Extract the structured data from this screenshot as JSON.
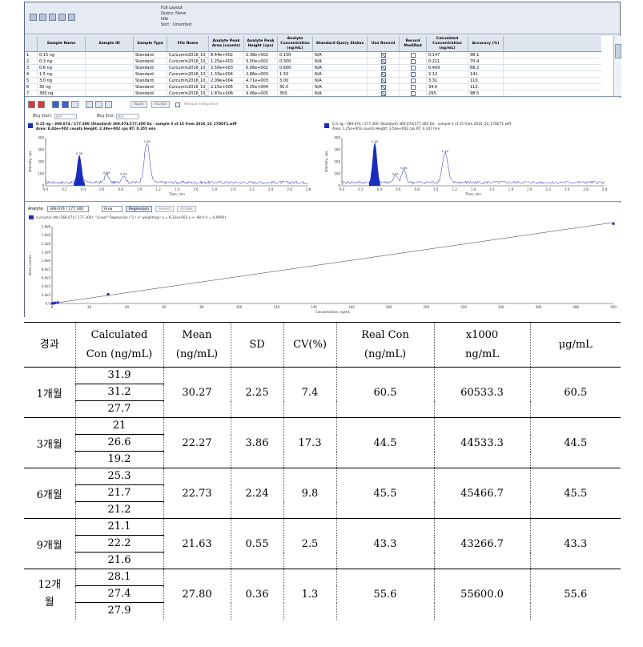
{
  "toolbar": {
    "info_lines": [
      "Full Layout",
      "Query: None",
      "Idle",
      "Sort : Unsorted"
    ]
  },
  "grid": {
    "columns": [
      "",
      "Sample Name",
      "Sample ID",
      "Sample Type",
      "File Name",
      "Analyte Peak Area (counts)",
      "Analyte Peak Height (cps)",
      "Analyte Concentration (ng/mL)",
      "Standard Query Status",
      "Use Record",
      "Record Modified",
      "Calculated Concentration (ng/mL)",
      "Accuracy (%)"
    ],
    "rows": [
      {
        "num": "1",
        "name": "0.15 ng",
        "id": "",
        "type": "Standard",
        "file": "Curcumin2016_10_",
        "area": "8.44e+002",
        "height": "2.38e+002",
        "conc": "0.150",
        "status": "N/A",
        "use": true,
        "mod": false,
        "calc": "0.147",
        "acc": "98.1"
      },
      {
        "num": "2",
        "name": "0.3 ng",
        "id": "",
        "type": "Standard",
        "file": "Curcumin2016_10_1",
        "area": "1.25e+003",
        "height": "3.50e+002",
        "conc": "0.300",
        "status": "N/A",
        "use": true,
        "mod": false,
        "calc": "0.211",
        "acc": "70.4"
      },
      {
        "num": "3",
        "name": "0.6 ng",
        "id": "",
        "type": "Standard",
        "file": "Curcumin2016_10_1",
        "area": "2.50e+003",
        "height": "6.06e+002",
        "conc": "0.600",
        "status": "N/A",
        "use": true,
        "mod": false,
        "calc": "0.409",
        "acc": "68.2"
      },
      {
        "num": "4",
        "name": "1.5 ng",
        "id": "",
        "type": "Standard",
        "file": "Curcumin2016_10_1",
        "area": "1.33e+004",
        "height": "2.86e+003",
        "conc": "1.50",
        "status": "N/A",
        "use": true,
        "mod": false,
        "calc": "2.12",
        "acc": "141."
      },
      {
        "num": "5",
        "name": "3.0 ng",
        "id": "",
        "type": "Standard",
        "file": "Curcumin2016_10_1",
        "area": "2.09e+004",
        "height": "4.71e+003",
        "conc": "3.00",
        "status": "N/A",
        "use": true,
        "mod": false,
        "calc": "3.31",
        "acc": "110."
      },
      {
        "num": "6",
        "name": "30 ng",
        "id": "",
        "type": "Standard",
        "file": "Curcumin2016_10_1",
        "area": "2.15e+005",
        "height": "5.35e+004",
        "conc": "30.0",
        "status": "N/A",
        "use": true,
        "mod": false,
        "calc": "34.0",
        "acc": "113."
      },
      {
        "num": "7",
        "name": "300 ng",
        "id": "",
        "type": "Standard",
        "file": "Curcumin2016_10_1",
        "area": "1.87e+006",
        "height": "4.06e+005",
        "conc": "300.",
        "status": "N/A",
        "use": true,
        "mod": false,
        "calc": "295.",
        "acc": "98.5"
      }
    ]
  },
  "chrom_toolbar": {
    "apply": "Apply",
    "accept": "Accept",
    "manual": "Manual Integration",
    "bkg_start_label": "Bkg Start:",
    "bkg_start_value": "N/A",
    "bkg_end_label": "Bkg End:",
    "bkg_end_value": "N/A"
  },
  "chrom_left": {
    "title_line1": "0.15 ng - 369.074 / 177.300 (Standard) 369.074/177.300 Da - sample 3 of 15 from 2016_10_17DET1.wiff",
    "title_line2": "Area: 8.44e+002 counts  Height: 2.38e+002 cps  RT: 0.355 min",
    "ylabel": "Intensity, cps",
    "xlabel": "Time, min",
    "yticks": [
      "400",
      "300",
      "200",
      "100",
      "0"
    ],
    "xticks": [
      "0.0",
      "0.2",
      "0.4",
      "0.6",
      "0.8",
      "1.0",
      "1.2",
      "1.4",
      "1.6",
      "1.8",
      "2.0",
      "2.2",
      "2.4",
      "2.6",
      "2.8"
    ],
    "peak_labels": [
      "0.36",
      "1.08",
      "0.65",
      "0.83"
    ]
  },
  "chrom_right": {
    "title_line1": "0.3 ng - 369.074 / 177.300 (Standard) 369.074/177.300 Da - sample 4 of 15 from 2016_10_17DET1.wiff",
    "title_line2": "Area: 1.25e+003 counts  Height: 3.50e+002 cps  RT: 0.347 min",
    "ylabel": "Intensity, cps",
    "xlabel": "Time, min",
    "yticks": [
      "400",
      "300",
      "200",
      "100",
      "0"
    ],
    "xticks": [
      "0.0",
      "0.2",
      "0.4",
      "0.6",
      "0.8",
      "1.0",
      "1.2",
      "1.4",
      "1.6",
      "1.8",
      "2.0",
      "2.2",
      "2.4",
      "2.6",
      "2.8"
    ],
    "peak_labels": [
      "0.35",
      "1.10",
      "0.66",
      "0.57"
    ]
  },
  "calib": {
    "analyte_label": "Analyte:",
    "analyte_value": "369.074 / 177.300",
    "area_value": "Area",
    "regression_btn": "Regression",
    "revert_btn": "Revert",
    "accept_btn": "Accept",
    "equation": "curcumin.rdb (369.074 / 177.300): \"Linear\" Regression (\"1 / x\" weighting): y = 6.32e+003 x + -98.0 (r = 0.9995)",
    "ylabel": "Area, counts",
    "xlabel": "Concentration, ng/mL",
    "yticks": [
      "1.8e6",
      "1.6e6",
      "1.4e6",
      "1.2e6",
      "1.0e6",
      "8.0e5",
      "6.0e5",
      "4.0e5",
      "2.0e5",
      "0.0"
    ],
    "xticks": [
      "0",
      "20",
      "40",
      "60",
      "80",
      "100",
      "120",
      "140",
      "160",
      "180",
      "200",
      "220",
      "240",
      "260",
      "280",
      "300"
    ]
  },
  "table": {
    "headers": {
      "period": "경과",
      "calc_line1": "Calculated",
      "calc_line2": "Con  (ng/mL)",
      "mean_line1": "Mean",
      "mean_line2": "(ng/mL)",
      "sd": "SD",
      "cv": "CV(%)",
      "real_line1": "Real  Con",
      "real_line2": "(ng/mL)",
      "x1000_line1": "x1000",
      "x1000_line2": "ng/mL",
      "ugml": "μg/mL"
    },
    "groups": [
      {
        "period": "1개월",
        "values": [
          "31.9",
          "31.2",
          "27.7"
        ],
        "mean": "30.27",
        "sd": "2.25",
        "cv": "7.4",
        "real": "60.5",
        "x1000": "60533.3",
        "ugml": "60.5"
      },
      {
        "period": "3개월",
        "values": [
          "21",
          "26.6",
          "19.2"
        ],
        "mean": "22.27",
        "sd": "3.86",
        "cv": "17.3",
        "real": "44.5",
        "x1000": "44533.3",
        "ugml": "44.5"
      },
      {
        "period": "6개월",
        "values": [
          "25.3",
          "21.7",
          "21.2"
        ],
        "mean": "22.73",
        "sd": "2.24",
        "cv": "9.8",
        "real": "45.5",
        "x1000": "45466.7",
        "ugml": "45.5"
      },
      {
        "period": "9개월",
        "values": [
          "21.1",
          "22.2",
          "21.6"
        ],
        "mean": "21.63",
        "sd": "0.55",
        "cv": "2.5",
        "real": "43.3",
        "x1000": "43266.7",
        "ugml": "43.3"
      },
      {
        "period_line1": "12개",
        "period_line2": "월",
        "values": [
          "28.1",
          "27.4",
          "27.9"
        ],
        "mean": "27.80",
        "sd": "0.36",
        "cv": "1.3",
        "real": "55.6",
        "x1000": "55600.0",
        "ugml": "55.6"
      }
    ]
  }
}
